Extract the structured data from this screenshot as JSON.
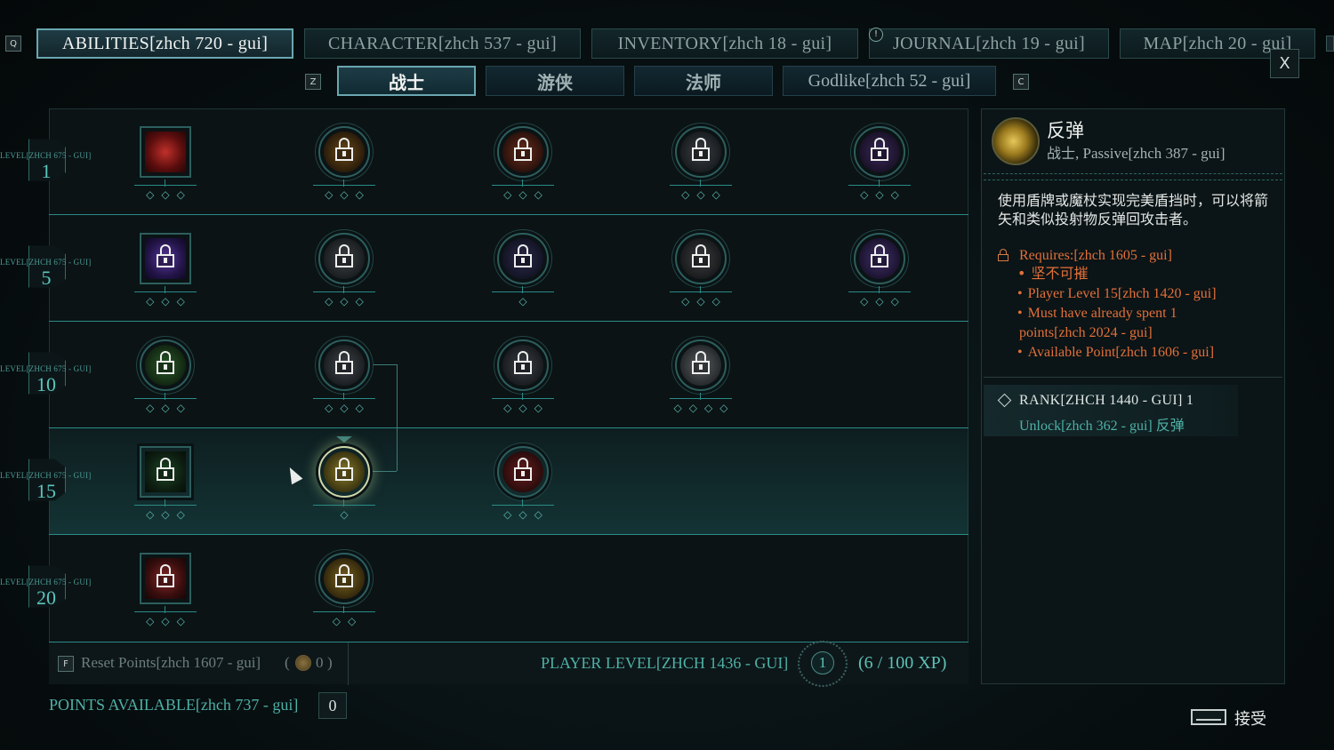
{
  "keys": {
    "prev_tab": "Q",
    "prev_sub": "Z",
    "next_sub": "C",
    "reset": "F"
  },
  "tabs": [
    {
      "label": "ABILITIES[zhch 720 - gui]"
    },
    {
      "label": "CHARACTER[zhch 537 - gui]"
    },
    {
      "label": "INVENTORY[zhch 18 - gui]"
    },
    {
      "label": "JOURNAL[zhch 19 - gui]"
    },
    {
      "label": "MAP[zhch 20 - gui]"
    }
  ],
  "journal_notice": "!",
  "close_label": "X",
  "subtabs": [
    {
      "label": "战士"
    },
    {
      "label": "游侠"
    },
    {
      "label": "法师"
    },
    {
      "label": "Godlike[zhch 52 - gui]"
    }
  ],
  "level_label": "LEVEL[ZHCH 675 - GUI]",
  "levels": [
    "1",
    "5",
    "10",
    "15",
    "20"
  ],
  "icons": {
    "r1": [
      "red-bull-icon",
      "lantern-icon",
      "fist-icon",
      "helm-icon",
      "rune-icon"
    ],
    "r2": [
      "purple-burst-icon",
      "hammer-icon",
      "dark-orb-icon",
      "spiked-helm-icon",
      "purple-cross-icon"
    ],
    "r3": [
      "green-leaf-icon",
      "shield-icon",
      "swirl-icon",
      "spiked-ball-icon"
    ],
    "r4": [
      "green-swirl-icon",
      "reflect-icon",
      "red-eye-icon"
    ],
    "r5": [
      "red-spiral-icon",
      "gold-sun-icon"
    ]
  },
  "pips": {
    "r1": [
      "◇◇◇",
      "◇◇◇",
      "◇◇◇",
      "◇◇◇",
      "◇◇◇"
    ],
    "r2": [
      "◇◇◇",
      "◇◇◇",
      "◇",
      "◇◇◇",
      "◇◇◇"
    ],
    "r3": [
      "◇◇◇",
      "◇◇◇",
      "◇◇◇",
      "◇◇◇◇"
    ],
    "r4": [
      "◇◇◇",
      "◇",
      "◇◇◇"
    ],
    "r5": [
      "◇◇◇",
      "◇◇"
    ]
  },
  "bottom_bar": {
    "reset_label": "Reset Points[zhch 1607 - gui]",
    "reset_value": "0",
    "player_level_label": "PLAYER LEVEL[ZHCH 1436 - GUI]",
    "player_level": "1",
    "xp": "(6 / 100 XP)"
  },
  "points_available_label": "POINTS AVAILABLE[zhch 737 - gui]",
  "points_available": "0",
  "detail": {
    "title": "反弹",
    "class": "战士",
    "type": ", Passive[zhch 387 - gui]",
    "description": "使用盾牌或魔杖实现完美盾挡时，可以将箭矢和类似投射物反弹回攻击者。",
    "requires_label": "Requires:[zhch 1605 - gui]",
    "requirements": [
      "坚不可摧",
      "Player Level 15[zhch 1420 - gui]",
      "Must have already spent 1",
      "points[zhch 2024 - gui]",
      "Available Point[zhch 1606 - gui]"
    ],
    "rank_label": "RANK[ZHCH 1440 - GUI] 1",
    "unlock_label": "Unlock[zhch 362 - gui]",
    "unlock_target": "反弹"
  },
  "accept_label": "接受",
  "colors": {
    "accent_teal": "#2a8b87",
    "active_tab_border": "#6aa7b0",
    "requirement_orange": "#e2703a",
    "level_number": "#5cc6bd"
  }
}
